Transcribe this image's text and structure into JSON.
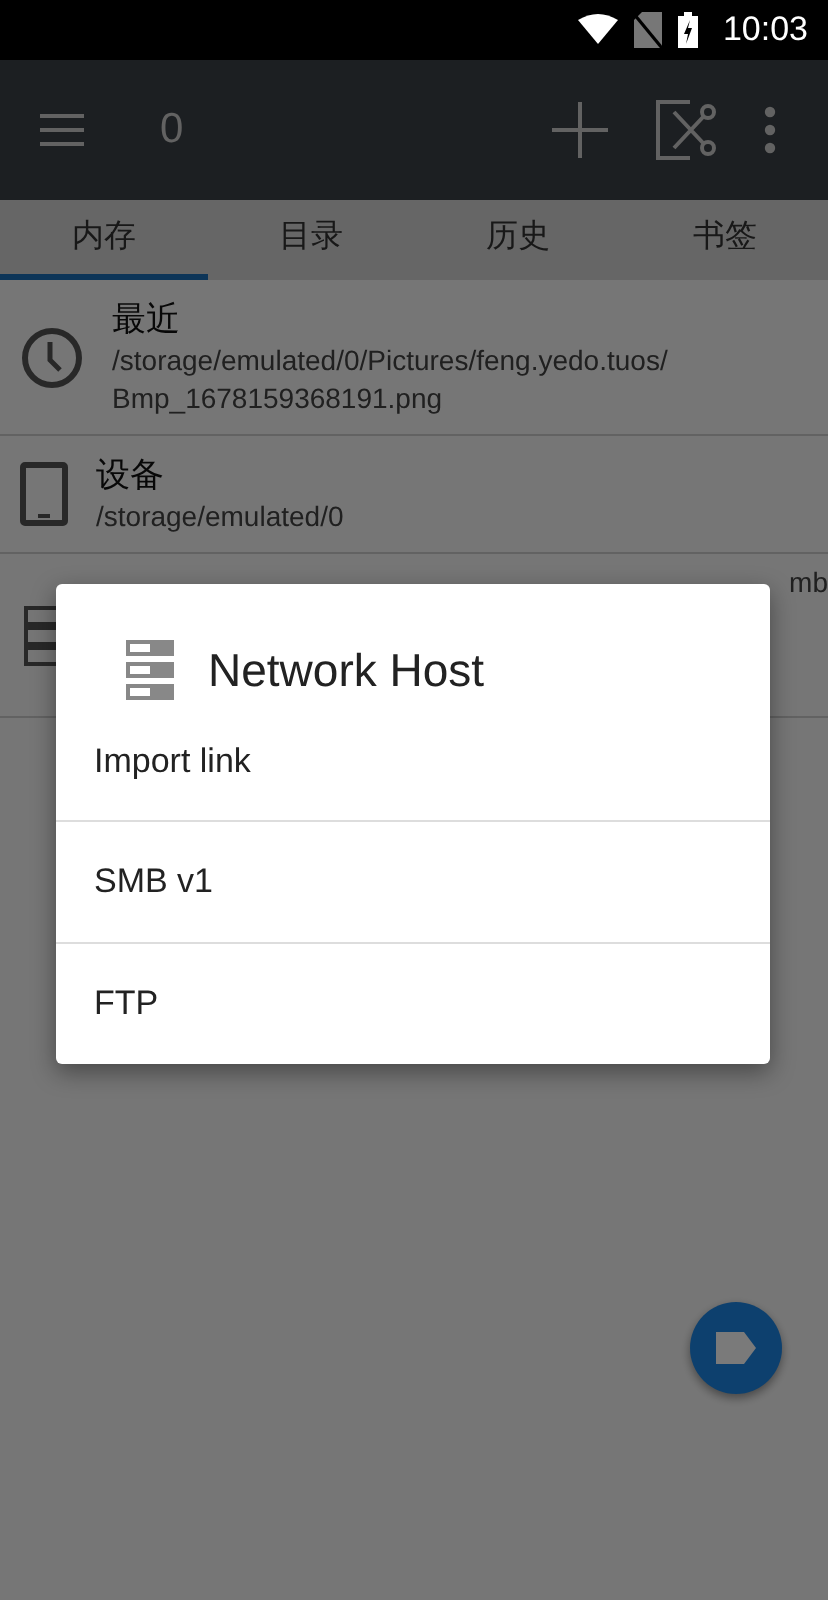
{
  "status_bar": {
    "time": "10:03"
  },
  "toolbar": {
    "title": "0"
  },
  "tabs": [
    {
      "label": "内存",
      "selected": true
    },
    {
      "label": "目录",
      "selected": false
    },
    {
      "label": "历史",
      "selected": false
    },
    {
      "label": "书签",
      "selected": false
    }
  ],
  "entries": [
    {
      "kind": "recent",
      "title": "最近",
      "path": "/storage/emulated/0/Pictures/feng.yedo.tuos/ Bmp_1678159368191.png"
    },
    {
      "kind": "device",
      "title": "设备",
      "path": "/storage/emulated/0"
    },
    {
      "kind": "network",
      "visible_text": "mb"
    }
  ],
  "dialog": {
    "title": "Network Host",
    "items": [
      "Import link",
      "SMB v1",
      "FTP"
    ]
  }
}
